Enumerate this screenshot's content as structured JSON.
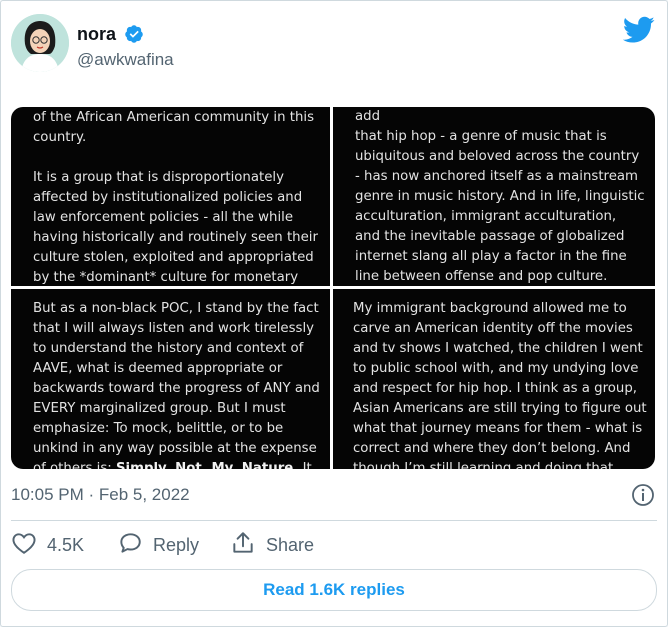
{
  "user": {
    "display_name": "nora",
    "handle": "@awkwafina",
    "verified_icon": "verified-badge-icon",
    "avatar_icon": "avatar"
  },
  "colors": {
    "accent": "#1d9bf0",
    "muted": "#536471",
    "text": "#0f1419",
    "border": "#cfd9de",
    "panel_bg": "#050505"
  },
  "media": {
    "panel1": "of the African American community in this\ncountry.\n\nIt is a group that is disproportionately\naffected by institutionalized policies and\nlaw enforcement policies - all the while\nhaving historically and routinely seen their\nculture stolen, exploited and appropriated\nby the *dominant* culture for monetary",
    "panel2": "generation - that liberally uses AAVE, to add\nthat hip hop - a genre of music that is\nubiquitous and beloved across the country\n- has now anchored itself as a mainstream\ngenre in music history. And in life, linguistic\nacculturation,  immigrant acculturation,\nand the inevitable passage of globalized\ninternet slang all play a factor in the fine\nline between offense and pop culture.",
    "panel3": "But as a non-black POC, I stand by the fact\nthat I will always listen and work tirelessly\nto understand the history and context of\nAAVE, what is deemed appropriate or\nbackwards toward the progress of ANY and\nEVERY marginalized group.  But I must\nemphasize: To mock, belittle, or to be\nunkind in any way possible at the expense\nof others is: ",
    "panel3_bold": "Simply. Not. My. Nature.",
    "panel3_tail": " It",
    "panel4": "My immigrant background allowed me to\ncarve an American identity off the movies\nand tv shows I watched, the children I went\nto public school with,  and my undying love\nand respect for hip hop. I think as a group,\nAsian Americans are still trying to figure out\nwhat that journey means for them - what is\ncorrect and where they don’t belong. And\nthough I’m still learning and doing that"
  },
  "timestamp": "10:05 PM · Feb 5, 2022",
  "actions": {
    "likes": "4.5K",
    "reply": "Reply",
    "share": "Share"
  },
  "read_replies": "Read 1.6K replies"
}
